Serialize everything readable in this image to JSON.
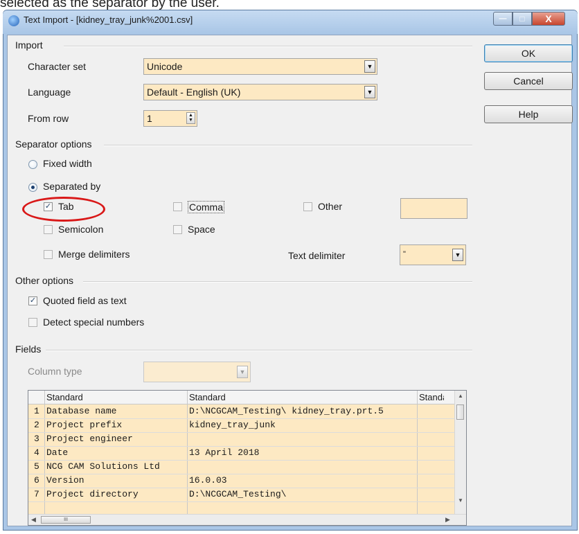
{
  "caption": "selected as the separator by the user.",
  "window": {
    "title": "Text Import - [kidney_tray_junk%2001.csv]",
    "min_glyph": "—",
    "max_glyph": "□",
    "close_glyph": "X"
  },
  "import": {
    "section_label": "Import",
    "charset_label": "Character set",
    "charset_value": "Unicode",
    "language_label": "Language",
    "language_value": "Default - English (UK)",
    "from_row_label": "From row",
    "from_row_value": "1"
  },
  "buttons": {
    "ok": "OK",
    "cancel": "Cancel",
    "help": "Help"
  },
  "separator": {
    "section_label": "Separator options",
    "fixed_width": "Fixed width",
    "separated_by": "Separated by",
    "tab": "Tab",
    "comma": "Comma",
    "other": "Other",
    "semicolon": "Semicolon",
    "space": "Space",
    "merge_delimiters": "Merge delimiters",
    "text_delimiter_label": "Text delimiter",
    "text_delimiter_value": "\""
  },
  "other_options": {
    "section_label": "Other options",
    "quoted_field": "Quoted field as text",
    "detect_special": "Detect special numbers"
  },
  "fields": {
    "section_label": "Fields",
    "column_type_label": "Column type",
    "headers": [
      "Standard",
      "Standard",
      "Standard"
    ],
    "rows": [
      {
        "num": "1",
        "a": "Database name",
        "b": "D:\\NCGCAM_Testing\\ kidney_tray.prt.5"
      },
      {
        "num": "2",
        "a": "Project prefix",
        "b": "kidney_tray_junk"
      },
      {
        "num": "3",
        "a": "Project engineer",
        "b": ""
      },
      {
        "num": "4",
        "a": "Date",
        "b": "13 April 2018"
      },
      {
        "num": "5",
        "a": "NCG CAM Solutions Ltd",
        "b": ""
      },
      {
        "num": "6",
        "a": "Version",
        "b": "16.0.03"
      },
      {
        "num": "7",
        "a": "Project directory",
        "b": "D:\\NCGCAM_Testing\\"
      }
    ],
    "scroll_thumb_glyph": "III"
  }
}
